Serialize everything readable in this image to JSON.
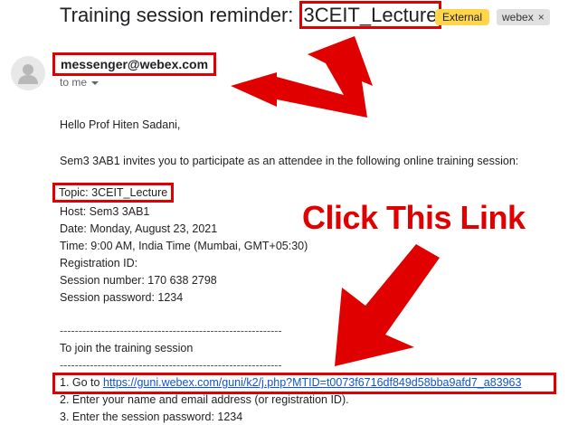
{
  "email": {
    "subject": "Training session reminder: ",
    "subject_highlight": "3CEIT_Lecture",
    "labels": {
      "external": "External",
      "webex": "webex",
      "close": "×"
    },
    "sender": "messenger@webex.com",
    "recipient": "to me",
    "greeting": "Hello Prof Hiten Sadani,",
    "invite": "Sem3 3AB1 invites you to participate as an attendee in the following online training session:",
    "topic": "Topic: 3CEIT_Lecture",
    "host": "Host: Sem3 3AB1",
    "date": "Date: Monday, August 23, 2021",
    "time": "Time: 9:00 AM, India Time (Mumbai, GMT+05:30)",
    "registration": "Registration ID:",
    "session_number": "Session number: 170 638 2798",
    "session_password": "Session password: 1234",
    "divider": "-----------------------------------------------------------",
    "join_heading": "To join the training session",
    "step1_prefix": "1. Go to ",
    "step1_link": "https://guni.webex.com/guni/k2/j.php?MTID=t0073f6716df849d58bba9afd7_a83963",
    "step2": "2. Enter your name and email address (or registration ID).",
    "step3": "3. Enter the session password: 1234"
  },
  "annotation": {
    "callout": "Click This Link",
    "color": "#e00000"
  }
}
